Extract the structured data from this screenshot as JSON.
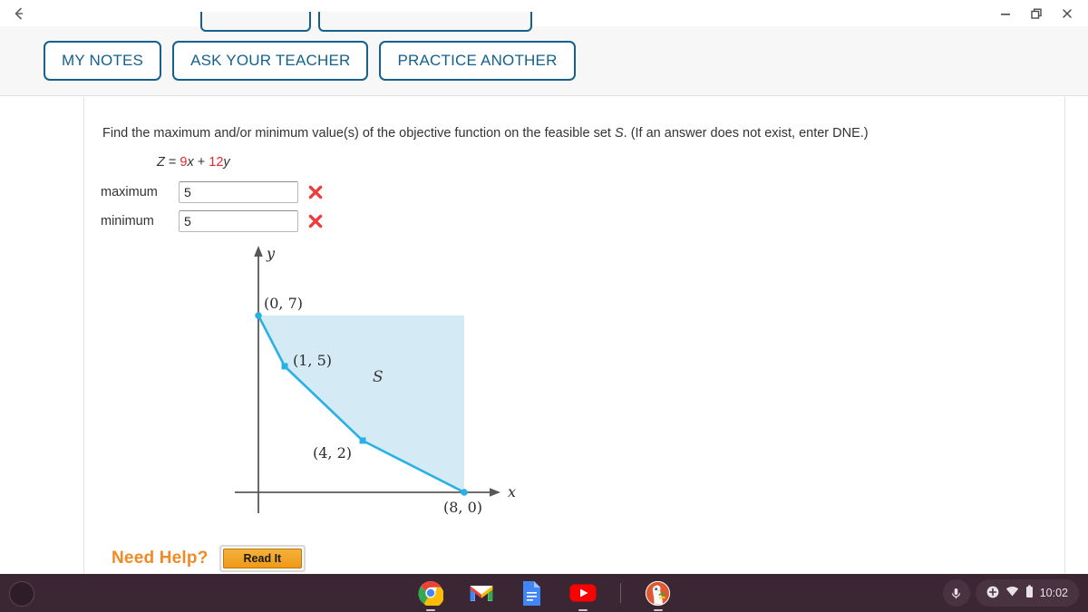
{
  "window": {
    "back_icon": "back-arrow-icon",
    "minimize_label": "minimize",
    "restore_label": "restore",
    "close_label": "close"
  },
  "toolbar": {
    "buttons": [
      {
        "label": "MY NOTES",
        "name": "my-notes-button"
      },
      {
        "label": "ASK YOUR TEACHER",
        "name": "ask-your-teacher-button"
      },
      {
        "label": "PRACTICE ANOTHER",
        "name": "practice-another-button"
      }
    ],
    "accent": "#14628c"
  },
  "question": {
    "prompt_part1": "Find the maximum and/or minimum value(s) of the objective function on the feasible set ",
    "prompt_set": "S",
    "prompt_part2": ". (If an answer does not exist, enter DNE.)",
    "objective": {
      "z": "Z",
      "equals": "=",
      "coef_x": "9",
      "var_x": "x",
      "plus": "+",
      "coef_y": "12",
      "var_y": "y",
      "number_color": "#e8282b"
    }
  },
  "answers": {
    "rows": [
      {
        "label": "maximum",
        "value": "5",
        "placeholder": "",
        "status": "incorrect"
      },
      {
        "label": "minimum",
        "value": "5",
        "placeholder": "",
        "status": "incorrect"
      }
    ],
    "incorrect_color": "#ef3b3b"
  },
  "need_help": {
    "label": "Need Help?",
    "button_label": "Read It",
    "label_color": "#f08a24"
  },
  "chart_data": {
    "type": "scatter",
    "title": "",
    "xlabel": "x",
    "ylabel": "y",
    "region_label": "S",
    "xlim": [
      0,
      11
    ],
    "ylim": [
      0,
      9
    ],
    "grid": false,
    "legend": false,
    "series": [
      {
        "name": "boundary",
        "points": [
          {
            "x": 0,
            "y": 7,
            "label": "(0, 7)"
          },
          {
            "x": 1,
            "y": 5,
            "label": "(1, 5)"
          },
          {
            "x": 4,
            "y": 2,
            "label": "(4, 2)"
          },
          {
            "x": 8,
            "y": 0,
            "label": "(8, 0)"
          }
        ],
        "color": "#29b0e5"
      }
    ],
    "shaded_region": {
      "label": "S",
      "fill": "#d4eaf5",
      "description": "feasible set bounded below-left by the boundary polyline and extending up and right"
    },
    "annotations": [
      {
        "text": "(0, 7)",
        "x": 0,
        "y": 7
      },
      {
        "text": "(1, 5)",
        "x": 1,
        "y": 5
      },
      {
        "text": "(4, 2)",
        "x": 4,
        "y": 2
      },
      {
        "text": "(8, 0)",
        "x": 8,
        "y": 0
      },
      {
        "text": "S",
        "x": 4.7,
        "y": 4.2
      }
    ]
  },
  "shelf": {
    "apps": [
      {
        "name": "chrome-icon",
        "label": "Chrome"
      },
      {
        "name": "gmail-icon",
        "label": "Gmail"
      },
      {
        "name": "google-docs-icon",
        "label": "Docs"
      },
      {
        "name": "youtube-icon",
        "label": "YouTube"
      },
      {
        "name": "duckduckgo-icon",
        "label": "DuckDuckGo"
      }
    ],
    "tray": {
      "mic_icon": "microphone-icon",
      "accessibility_icon": "plus-circle-icon",
      "wifi_icon": "wifi-icon",
      "battery_icon": "battery-icon",
      "time": "10:02"
    },
    "background": "#3b2733"
  }
}
